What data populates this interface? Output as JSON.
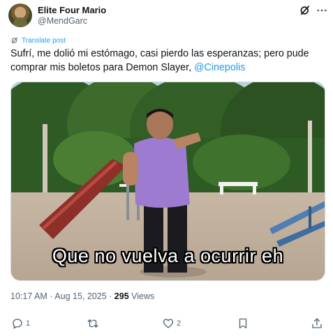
{
  "author": {
    "display_name": "Elite Four Mario",
    "handle": "@MendGarc"
  },
  "translate_label": "Translate post",
  "post": {
    "text_line1": "Sufrí, me dolió mi estómago, casi pierdo las esperanzas; pero pude",
    "text_line2": "comprar mis boletos para Demon Slayer, ",
    "mention": "@Cinepolis"
  },
  "media": {
    "caption": "Que no vuelva a ocurrir eh"
  },
  "meta": {
    "time": "10:17 AM",
    "date": "Aug 15, 2025",
    "views_count": "295",
    "views_label": "Views",
    "separator": "·"
  },
  "actions": {
    "replies": "1",
    "reposts": "",
    "likes": "2"
  },
  "colors": {
    "accent": "#1d9bf0",
    "text": "#0f1419",
    "muted": "#536471"
  }
}
